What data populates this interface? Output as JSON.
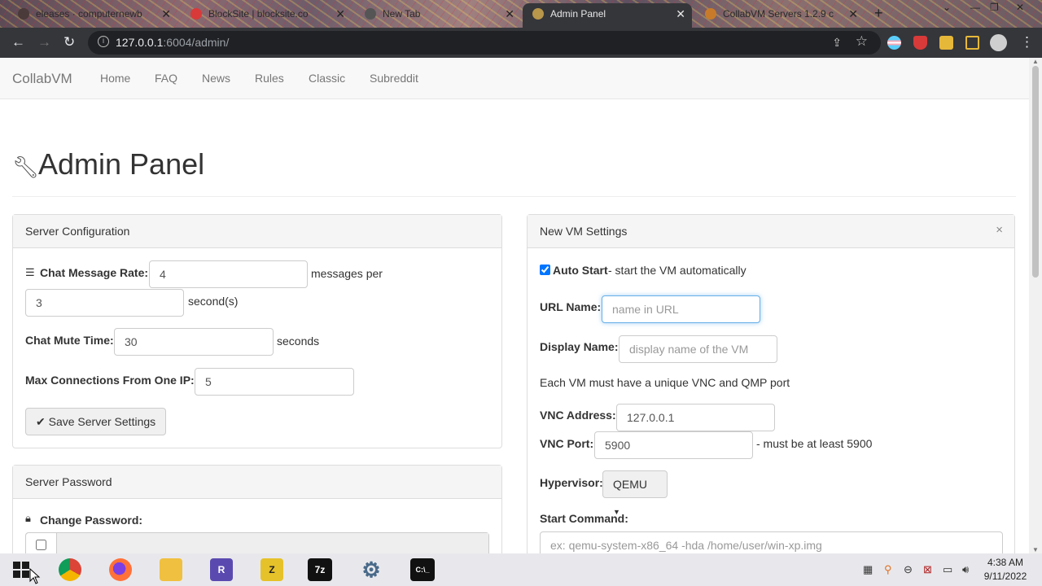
{
  "browser": {
    "tabs": [
      {
        "label": "eleases · computernewb",
        "active": false
      },
      {
        "label": "BlockSite | blocksite.co",
        "active": false
      },
      {
        "label": "New Tab",
        "active": false
      },
      {
        "label": "Admin Panel",
        "active": true
      },
      {
        "label": "CollabVM Servers 1.2.9 c",
        "active": false
      }
    ],
    "url_host": "127.0.0.1",
    "url_rest": ":6004/admin/"
  },
  "navbar": {
    "brand": "CollabVM",
    "links": [
      "Home",
      "FAQ",
      "News",
      "Rules",
      "Classic",
      "Subreddit"
    ]
  },
  "page": {
    "title": "Admin Panel"
  },
  "server_config": {
    "heading": "Server Configuration",
    "chat_rate_label": "Chat Message Rate:",
    "chat_rate_messages": "4",
    "messages_per": "messages per",
    "chat_rate_seconds": "3",
    "seconds_unit": "second(s)",
    "mute_label": "Chat Mute Time:",
    "mute_value": "30",
    "mute_unit": "seconds",
    "max_conn_label": "Max Connections From One IP:",
    "max_conn_value": "5",
    "save_button": "Save Server Settings"
  },
  "server_password": {
    "heading": "Server Password",
    "change_label": "Change Password:"
  },
  "vm_settings": {
    "heading": "New VM Settings",
    "close": "×",
    "auto_start_label": "Auto Start",
    "auto_start_desc": "- start the VM automatically",
    "url_name_label": "URL Name:",
    "url_name_placeholder": "name in URL",
    "display_name_label": "Display Name:",
    "display_name_placeholder": "display name of the VM",
    "unique_note": "Each VM must have a unique VNC and QMP port",
    "vnc_address_label": "VNC Address:",
    "vnc_address_value": "127.0.0.1",
    "vnc_port_label": "VNC Port:",
    "vnc_port_value": "5900",
    "vnc_port_note": "- must be at least 5900",
    "hypervisor_label": "Hypervisor:",
    "hypervisor_value": "QEMU",
    "start_command_label": "Start Command:",
    "start_command_placeholder": "ex: qemu-system-x86_64 -hda /home/user/win-xp.img"
  },
  "taskbar": {
    "time": "4:38 AM",
    "date": "9/11/2022"
  }
}
